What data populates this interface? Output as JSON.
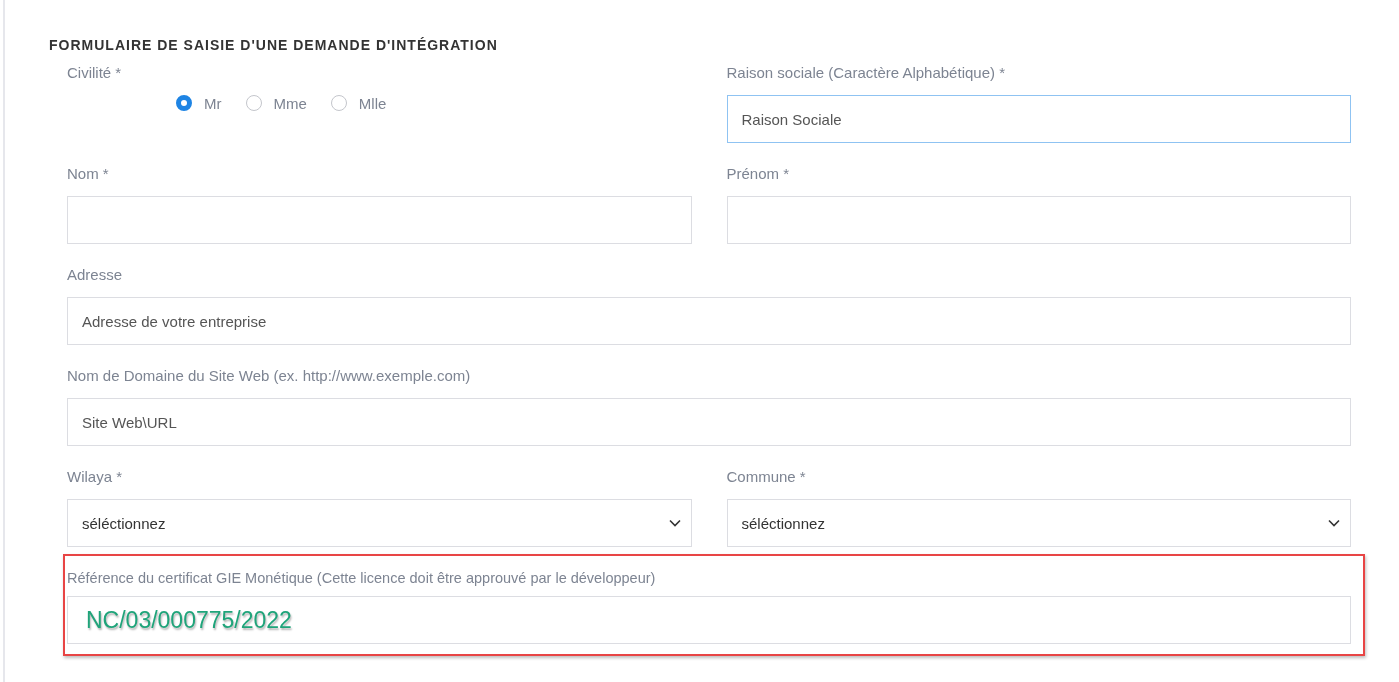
{
  "title": "FORMULAIRE DE SAISIE D'UNE DEMANDE D'INTÉGRATION",
  "rows": [
    {
      "cells": [
        {
          "kind": "radio",
          "label": "Civilité *",
          "options": [
            {
              "label": "Mr",
              "selected": true
            },
            {
              "label": "Mme",
              "selected": false
            },
            {
              "label": "Mlle",
              "selected": false
            }
          ]
        },
        {
          "kind": "text",
          "label": "Raison sociale (Caractère Alphabétique) *",
          "placeholder": "Raison Sociale",
          "focused": true
        }
      ]
    },
    {
      "cells": [
        {
          "kind": "text",
          "label": "Nom *",
          "focused": false
        },
        {
          "kind": "text",
          "label": "Prénom *",
          "focused": false
        }
      ]
    },
    {
      "cells": [
        {
          "kind": "text",
          "label": "Adresse",
          "placeholder": "Adresse de votre entreprise",
          "focused": false
        }
      ]
    },
    {
      "cells": [
        {
          "kind": "text",
          "label": "Nom de Domaine du Site Web (ex. http://www.exemple.com)",
          "placeholder": "Site Web\\URL",
          "focused": false
        }
      ]
    },
    {
      "cells": [
        {
          "kind": "select",
          "label": "Wilaya *",
          "value": "séléctionnez"
        },
        {
          "kind": "select",
          "label": "Commune *",
          "value": "séléctionnez"
        }
      ]
    },
    {
      "cells": [
        {
          "kind": "text",
          "label": "Référence du certificat GIE Monétique (Cette licence doit être approuvé par le développeur)",
          "value": "NC/03/000775/2022",
          "focused": false,
          "highlighted": true
        }
      ]
    }
  ]
}
